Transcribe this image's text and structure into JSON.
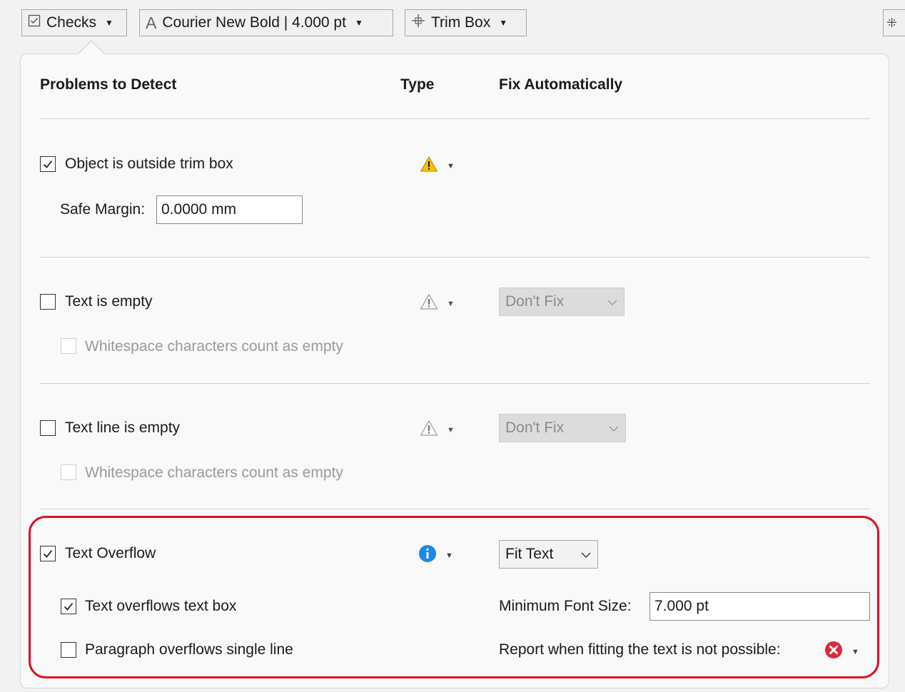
{
  "toolbar": {
    "checks_label": "Checks",
    "font_label": "Courier New Bold | 4.000 pt",
    "box_label": "Trim Box"
  },
  "headers": {
    "problems": "Problems to Detect",
    "type": "Type",
    "fix": "Fix Automatically"
  },
  "checks": {
    "outside_trim": {
      "label": "Object is outside trim box",
      "checked": true,
      "safe_margin_label": "Safe Margin:",
      "safe_margin_value": "0.0000 mm"
    },
    "text_empty": {
      "label": "Text is empty",
      "checked": false,
      "sub_label": "Whitespace characters count as empty",
      "fix": "Don't Fix"
    },
    "text_line_empty": {
      "label": "Text line is empty",
      "checked": false,
      "sub_label": "Whitespace characters count as empty",
      "fix": "Don't Fix"
    },
    "text_overflow": {
      "label": "Text Overflow",
      "checked": true,
      "fix": "Fit Text",
      "overflows_box_label": "Text overflows text box",
      "overflows_box_checked": true,
      "paragraph_label": "Paragraph overflows single line",
      "paragraph_checked": false,
      "min_font_label": "Minimum Font Size:",
      "min_font_value": "7.000 pt",
      "report_label": "Report when fitting the text is not possible:"
    }
  },
  "colors": {
    "warning": "#f5c400",
    "info": "#1e88e5",
    "error": "#e0283a",
    "highlight": "#e01020"
  }
}
